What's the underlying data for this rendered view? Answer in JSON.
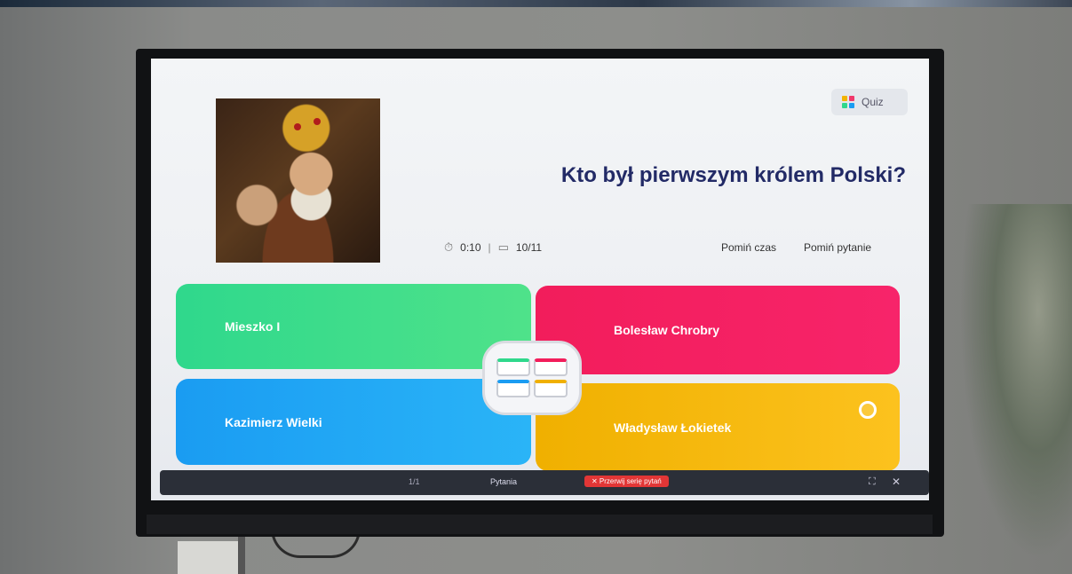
{
  "header": {
    "quiz_badge_label": "Quiz"
  },
  "question": {
    "text": "Kto był pierwszym królem Polski?",
    "timer": "0:10",
    "progress": "10/11",
    "skip_time_label": "Pomiń czas",
    "skip_question_label": "Pomiń pytanie"
  },
  "answers": [
    {
      "label": "Mieszko I",
      "color": "#2fd88c"
    },
    {
      "label": "Bolesław Chrobry",
      "color": "#f21d5b"
    },
    {
      "label": "Kazimierz Wielki",
      "color": "#1a9cf2"
    },
    {
      "label": "Władysław Łokietek",
      "color": "#f0b000"
    }
  ],
  "bottom_bar": {
    "page_indicator": "1/1",
    "label": "Pytania",
    "stop_button_label": "✕ Przerwij serię pytań"
  },
  "icons": {
    "timer": "stopwatch-icon",
    "progress": "cards-icon",
    "quiz": "quiz-grid-icon",
    "center": "controller-icon",
    "expand": "expand-icon",
    "close": "close-icon"
  }
}
